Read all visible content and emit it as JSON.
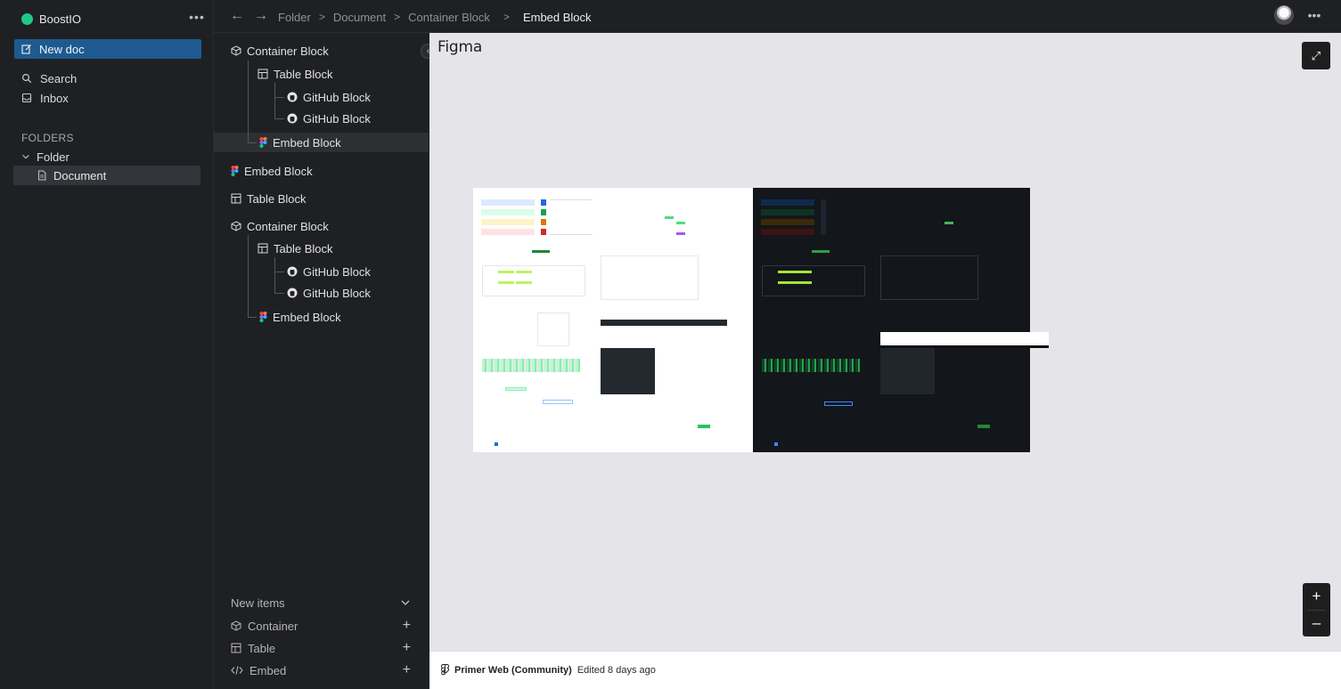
{
  "app": {
    "name": "BoostIO",
    "brand_color": "#21c788",
    "more_label": "•••"
  },
  "sidebar": {
    "new_doc_label": "New doc",
    "nav": [
      {
        "label": "Search",
        "icon": "search-icon"
      },
      {
        "label": "Inbox",
        "icon": "inbox-icon"
      }
    ],
    "folders_heading": "FOLDERS",
    "folder": {
      "label": "Folder",
      "icon": "chevron-down-icon"
    },
    "document": {
      "label": "Document",
      "icon": "document-icon"
    }
  },
  "topbar": {
    "breadcrumbs": [
      "Folder",
      "Document",
      "Container Block",
      "Embed Block"
    ],
    "more_label": "•••"
  },
  "tree": {
    "nodes": [
      {
        "label": "Container Block",
        "icon": "cube-icon"
      },
      {
        "label": "Table Block",
        "icon": "table-icon"
      },
      {
        "label": "GitHub Block",
        "icon": "github-icon"
      },
      {
        "label": "GitHub Block",
        "icon": "github-icon"
      },
      {
        "label": "Embed Block",
        "icon": "figma-icon",
        "active": true
      },
      {
        "label": "Embed Block",
        "icon": "figma-icon"
      },
      {
        "label": "Table Block",
        "icon": "table-icon"
      },
      {
        "label": "Container Block",
        "icon": "cube-icon"
      },
      {
        "label": "Table Block",
        "icon": "table-icon"
      },
      {
        "label": "GitHub Block",
        "icon": "github-icon"
      },
      {
        "label": "GitHub Block",
        "icon": "github-icon"
      },
      {
        "label": "Embed Block",
        "icon": "figma-icon"
      }
    ],
    "new_items_label": "New items",
    "new_items": [
      {
        "label": "Container",
        "icon": "cube-icon"
      },
      {
        "label": "Table",
        "icon": "table-icon"
      },
      {
        "label": "Embed",
        "icon": "code-icon"
      }
    ]
  },
  "embed": {
    "title": "Figma",
    "file_name": "Primer Web (Community)",
    "edited": "Edited 8 days ago",
    "background": "#e5e5e9"
  }
}
